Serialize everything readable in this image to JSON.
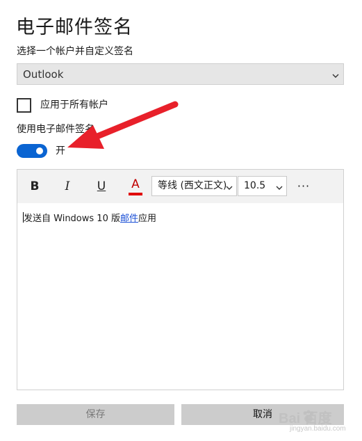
{
  "dialog": {
    "title": "电子邮件签名",
    "subtitle": "选择一个帐户并自定义签名"
  },
  "account_select": {
    "value": "Outlook",
    "icon": "chevron-down-icon"
  },
  "apply_all": {
    "label": "应用于所有帐户",
    "checked": false
  },
  "use_signature": {
    "label": "使用电子邮件签名",
    "toggle_state": "开",
    "on": true,
    "accent": "#0a64d2"
  },
  "toolbar": {
    "bold": "B",
    "italic": "I",
    "underline": "U",
    "font_color": "A",
    "font_color_hex": "#e00000",
    "font_name": "等线 (西文正文)",
    "font_size": "10.5",
    "more": "···"
  },
  "signature": {
    "text_before": "发送自 Windows 10 版",
    "link_text": "邮件",
    "text_after": "应用"
  },
  "buttons": {
    "save": "保存",
    "cancel": "取消"
  },
  "watermark": {
    "brand": "Bai  百度",
    "sub": "jingyan.baidu.com"
  },
  "annotation": {
    "arrow_color": "#e8202a"
  }
}
